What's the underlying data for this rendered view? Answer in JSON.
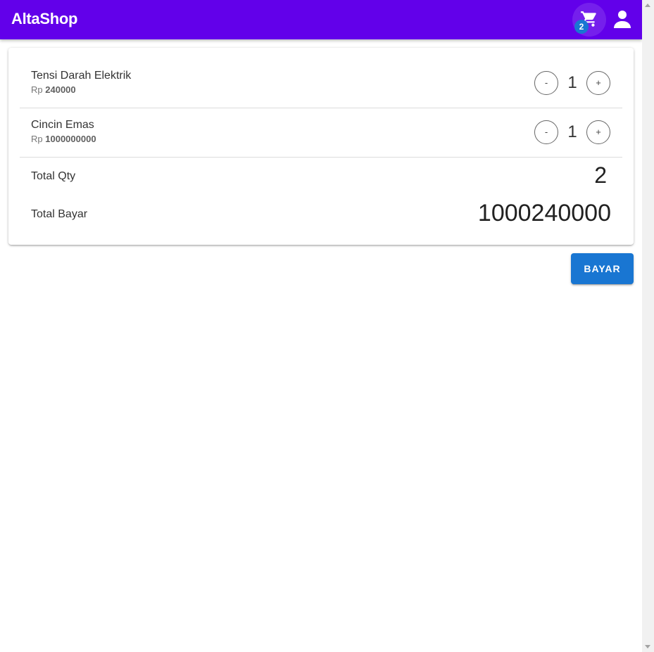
{
  "appbar": {
    "title": "AltaShop",
    "cart_icon": "cart-icon",
    "cart_count": "2",
    "user_icon": "user-icon",
    "color": "#6200ea"
  },
  "cart": {
    "items": [
      {
        "name": "Tensi Darah Elektrik",
        "currency": "Rp",
        "price": "240000",
        "qty": "1",
        "minus_label": "-",
        "plus_label": "+"
      },
      {
        "name": "Cincin Emas",
        "currency": "Rp",
        "price": "1000000000",
        "qty": "1",
        "minus_label": "-",
        "plus_label": "+"
      }
    ],
    "total_qty_label": "Total Qty",
    "total_qty": "2",
    "total_bayar_label": "Total Bayar",
    "total_bayar": "1000240000"
  },
  "actions": {
    "pay_label": "BAYAR",
    "pay_color": "#1976d2"
  }
}
